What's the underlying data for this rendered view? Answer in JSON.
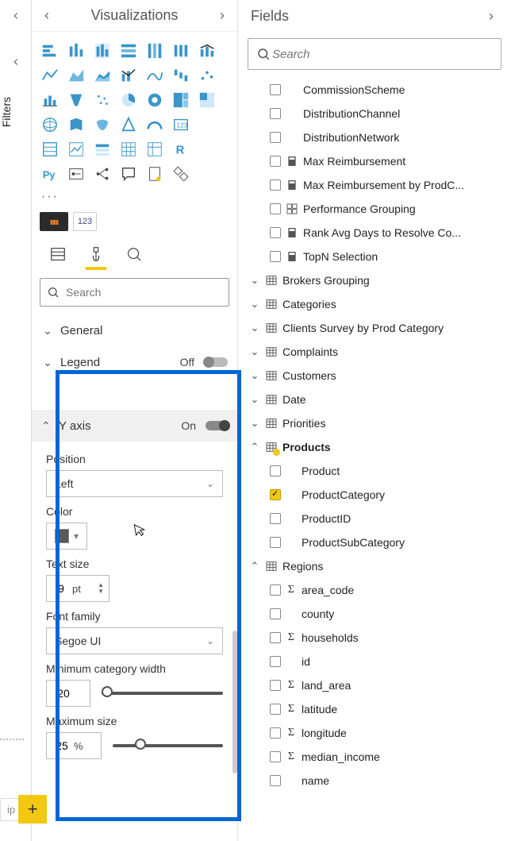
{
  "leftRail": {
    "filtersLabel": "Filters"
  },
  "viz": {
    "title": "Visualizations",
    "moreDots": "···",
    "wellNumLabel": "123",
    "searchPlaceholder": "Search",
    "sections": {
      "general": {
        "label": "General"
      },
      "legend": {
        "label": "Legend",
        "state": "Off"
      },
      "yaxis": {
        "label": "Y axis",
        "state": "On"
      }
    },
    "yaxisProps": {
      "positionLabel": "Position",
      "positionValue": "Left",
      "colorLabel": "Color",
      "textSizeLabel": "Text size",
      "textSizeValue": "9",
      "textSizeUnit": "pt",
      "fontFamilyLabel": "Font family",
      "fontFamilyValue": "Segoe UI",
      "minCatLabel": "Minimum category width",
      "minCatValue": "20",
      "maxSizeLabel": "Maximum size",
      "maxSizeValue": "25",
      "maxSizeUnit": "%"
    }
  },
  "fields": {
    "title": "Fields",
    "searchPlaceholder": "Search",
    "looseFields": [
      {
        "name": "CommissionScheme",
        "icon": ""
      },
      {
        "name": "DistributionChannel",
        "icon": ""
      },
      {
        "name": "DistributionNetwork",
        "icon": ""
      },
      {
        "name": "Max Reimbursement",
        "icon": "measure"
      },
      {
        "name": "Max Reimbursement by ProdC...",
        "icon": "measure"
      },
      {
        "name": "Performance Grouping",
        "icon": "group"
      },
      {
        "name": "Rank Avg Days to Resolve Co...",
        "icon": "measure"
      },
      {
        "name": "TopN Selection",
        "icon": "measure"
      }
    ],
    "tables": [
      {
        "name": "Brokers Grouping",
        "expanded": false
      },
      {
        "name": "Categories",
        "expanded": false
      },
      {
        "name": "Clients Survey by Prod Category",
        "expanded": false
      },
      {
        "name": "Complaints",
        "expanded": false
      },
      {
        "name": "Customers",
        "expanded": false
      },
      {
        "name": "Date",
        "expanded": false
      },
      {
        "name": "Priorities",
        "expanded": false
      },
      {
        "name": "Products",
        "expanded": true,
        "hasSelection": true,
        "fields": [
          {
            "name": "Product",
            "checked": false
          },
          {
            "name": "ProductCategory",
            "checked": true
          },
          {
            "name": "ProductID",
            "checked": false
          },
          {
            "name": "ProductSubCategory",
            "checked": false
          }
        ]
      },
      {
        "name": "Regions",
        "expanded": true,
        "fields": [
          {
            "name": "area_code",
            "sigma": true
          },
          {
            "name": "county"
          },
          {
            "name": "households",
            "sigma": true
          },
          {
            "name": "id"
          },
          {
            "name": "land_area",
            "sigma": true
          },
          {
            "name": "latitude",
            "sigma": true
          },
          {
            "name": "longitude",
            "sigma": true
          },
          {
            "name": "median_income",
            "sigma": true
          },
          {
            "name": "name"
          }
        ]
      }
    ]
  },
  "tip": {
    "label": "ip",
    "plus": "+"
  }
}
